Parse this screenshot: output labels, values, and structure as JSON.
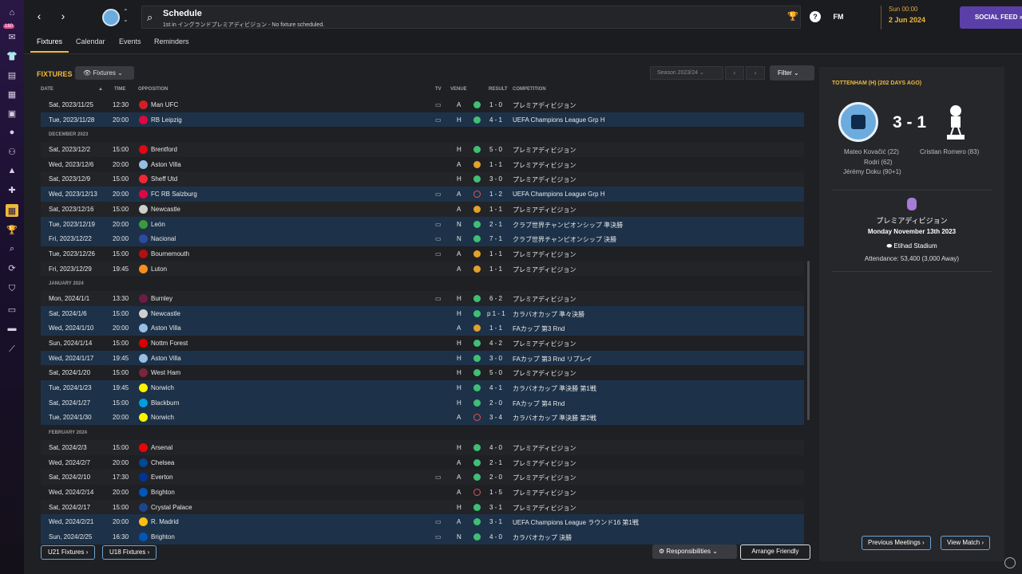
{
  "header": {
    "title": "Schedule",
    "subtitle": "1st in イングランドプレミアディビジョン - No fixture scheduled.",
    "time": "Sun 00:00",
    "date": "2 Jun 2024",
    "fm_label": "FM",
    "social_feed": "SOCIAL FEED",
    "help": "?",
    "badge": "160"
  },
  "tabs": [
    "Fixtures",
    "Calendar",
    "Events",
    "Reminders"
  ],
  "toolbar": {
    "heading": "FIXTURES",
    "dropdown": "Fixtures",
    "season": "Season 2023/24",
    "filter": "Filter"
  },
  "columns": {
    "date": "DATE",
    "time": "TIME",
    "opposition": "OPPOSITION",
    "tv": "TV",
    "venue": "VENUE",
    "result": "RESULT",
    "competition": "COMPETITION"
  },
  "rows": [
    {
      "date": "Sat, 2023/11/25",
      "time": "12:30",
      "opp": "Man UFC",
      "tv": true,
      "venue": "A",
      "res": "win",
      "score": "1 - 0",
      "comp": "プレミアディビジョン",
      "color": "#d21f26"
    },
    {
      "date": "Tue, 2023/11/28",
      "time": "20:00",
      "opp": "RB Leipzig",
      "tv": true,
      "venue": "H",
      "res": "win",
      "score": "4 - 1",
      "comp": "UEFA Champions League Grp H",
      "ucl": true,
      "color": "#dd0741"
    },
    {
      "month": "DECEMBER 2023"
    },
    {
      "date": "Sat, 2023/12/2",
      "time": "15:00",
      "opp": "Brentford",
      "tv": false,
      "venue": "H",
      "res": "win",
      "score": "5 - 0",
      "comp": "プレミアディビジョン",
      "color": "#e30613"
    },
    {
      "date": "Wed, 2023/12/6",
      "time": "20:00",
      "opp": "Aston Villa",
      "tv": false,
      "venue": "A",
      "res": "draw",
      "score": "1 - 1",
      "comp": "プレミアディビジョン",
      "color": "#95bfe5"
    },
    {
      "date": "Sat, 2023/12/9",
      "time": "15:00",
      "opp": "Sheff Utd",
      "tv": false,
      "venue": "H",
      "res": "win",
      "score": "3 - 0",
      "comp": "プレミアディビジョン",
      "color": "#ee2737"
    },
    {
      "date": "Wed, 2023/12/13",
      "time": "20:00",
      "opp": "FC RB Salzburg",
      "tv": true,
      "venue": "A",
      "res": "loss",
      "score": "1 - 2",
      "comp": "UEFA Champions League Grp H",
      "ucl": true,
      "color": "#dd0741"
    },
    {
      "date": "Sat, 2023/12/16",
      "time": "15:00",
      "opp": "Newcastle",
      "tv": false,
      "venue": "A",
      "res": "draw",
      "score": "1 - 1",
      "comp": "プレミアディビジョン",
      "color": "#cfcfcf"
    },
    {
      "date": "Tue, 2023/12/19",
      "time": "20:00",
      "opp": "León",
      "tv": true,
      "venue": "N",
      "res": "win",
      "score": "2 - 1",
      "comp": "クラブ世界チャンピオンシップ 準決勝",
      "ucl": true,
      "color": "#3a9b3a"
    },
    {
      "date": "Fri, 2023/12/22",
      "time": "20:00",
      "opp": "Nacional",
      "tv": true,
      "venue": "N",
      "res": "win",
      "score": "7 - 1",
      "comp": "クラブ世界チャンピオンシップ 決勝",
      "ucl": true,
      "color": "#2c4ba0"
    },
    {
      "date": "Tue, 2023/12/26",
      "time": "15:00",
      "opp": "Bournemouth",
      "tv": true,
      "venue": "A",
      "res": "draw",
      "score": "1 - 1",
      "comp": "プレミアディビジョン",
      "color": "#b50e12"
    },
    {
      "date": "Fri, 2023/12/29",
      "time": "19:45",
      "opp": "Luton",
      "tv": false,
      "venue": "A",
      "res": "draw",
      "score": "1 - 1",
      "comp": "プレミアディビジョン",
      "color": "#f78f1e"
    },
    {
      "month": "JANUARY 2024"
    },
    {
      "date": "Mon, 2024/1/1",
      "time": "13:30",
      "opp": "Burnley",
      "tv": true,
      "venue": "H",
      "res": "win",
      "score": "6 - 2",
      "comp": "プレミアディビジョン",
      "color": "#6c1d45"
    },
    {
      "date": "Sat, 2024/1/6",
      "time": "15:00",
      "opp": "Newcastle",
      "tv": false,
      "venue": "H",
      "res": "win",
      "score": "p 1 - 1",
      "comp": "カラバオカップ 準々決勝",
      "ucl": true,
      "color": "#cfcfcf"
    },
    {
      "date": "Wed, 2024/1/10",
      "time": "20:00",
      "opp": "Aston Villa",
      "tv": false,
      "venue": "A",
      "res": "draw",
      "score": "1 - 1",
      "comp": "FAカップ 第3 Rnd",
      "ucl": true,
      "color": "#95bfe5"
    },
    {
      "date": "Sun, 2024/1/14",
      "time": "15:00",
      "opp": "Nottm Forest",
      "tv": false,
      "venue": "H",
      "res": "win",
      "score": "4 - 2",
      "comp": "プレミアディビジョン",
      "color": "#dd0000"
    },
    {
      "date": "Wed, 2024/1/17",
      "time": "19:45",
      "opp": "Aston Villa",
      "tv": false,
      "venue": "H",
      "res": "win",
      "score": "3 - 0",
      "comp": "FAカップ 第3 Rnd リプレイ",
      "ucl": true,
      "color": "#95bfe5"
    },
    {
      "date": "Sat, 2024/1/20",
      "time": "15:00",
      "opp": "West Ham",
      "tv": false,
      "venue": "H",
      "res": "win",
      "score": "5 - 0",
      "comp": "プレミアディビジョン",
      "color": "#7a263a"
    },
    {
      "date": "Tue, 2024/1/23",
      "time": "19:45",
      "opp": "Norwich",
      "tv": false,
      "venue": "H",
      "res": "win",
      "score": "4 - 1",
      "comp": "カラバオカップ 準決勝 第1戦",
      "ucl": true,
      "color": "#fff200"
    },
    {
      "date": "Sat, 2024/1/27",
      "time": "15:00",
      "opp": "Blackburn",
      "tv": false,
      "venue": "H",
      "res": "win",
      "score": "2 - 0",
      "comp": "FAカップ 第4 Rnd",
      "ucl": true,
      "color": "#009ee0"
    },
    {
      "date": "Tue, 2024/1/30",
      "time": "20:00",
      "opp": "Norwich",
      "tv": false,
      "venue": "A",
      "res": "loss",
      "score": "3 - 4",
      "comp": "カラバオカップ 準決勝 第2戦",
      "ucl": true,
      "color": "#fff200"
    },
    {
      "month": "FEBRUARY 2024"
    },
    {
      "date": "Sat, 2024/2/3",
      "time": "15:00",
      "opp": "Arsenal",
      "tv": false,
      "venue": "H",
      "res": "win",
      "score": "4 - 0",
      "comp": "プレミアディビジョン",
      "color": "#ef0107"
    },
    {
      "date": "Wed, 2024/2/7",
      "time": "20:00",
      "opp": "Chelsea",
      "tv": false,
      "venue": "A",
      "res": "win",
      "score": "2 - 1",
      "comp": "プレミアディビジョン",
      "color": "#034694"
    },
    {
      "date": "Sat, 2024/2/10",
      "time": "17:30",
      "opp": "Everton",
      "tv": true,
      "venue": "A",
      "res": "win",
      "score": "2 - 0",
      "comp": "プレミアディビジョン",
      "color": "#003399"
    },
    {
      "date": "Wed, 2024/2/14",
      "time": "20:00",
      "opp": "Brighton",
      "tv": false,
      "venue": "A",
      "res": "loss",
      "score": "1 - 5",
      "comp": "プレミアディビジョン",
      "color": "#0057b8"
    },
    {
      "date": "Sat, 2024/2/17",
      "time": "15:00",
      "opp": "Crystal Palace",
      "tv": false,
      "venue": "H",
      "res": "win",
      "score": "3 - 1",
      "comp": "プレミアディビジョン",
      "color": "#1b458f"
    },
    {
      "date": "Wed, 2024/2/21",
      "time": "20:00",
      "opp": "R. Madrid",
      "tv": true,
      "venue": "A",
      "res": "win",
      "score": "3 - 1",
      "comp": "UEFA Champions League ラウンド16 第1戦",
      "ucl": true,
      "color": "#febe10"
    },
    {
      "date": "Sun, 2024/2/25",
      "time": "16:30",
      "opp": "Brighton",
      "tv": true,
      "venue": "N",
      "res": "win",
      "score": "4 - 0",
      "comp": "カラバオカップ 決勝",
      "ucl": true,
      "color": "#0057b8"
    }
  ],
  "bottom": {
    "u21": "U21 Fixtures",
    "u18": "U18 Fixtures",
    "responsibilities": "Responsibilities",
    "arrange": "Arrange Friendly"
  },
  "panel": {
    "title": "TOTTENHAM (H) (202 DAYS AGO)",
    "score": "3 - 1",
    "home_scorers": [
      "Mateo Kovačić (22)",
      "Rodri (62)",
      "Jérémy Doku (90+1)"
    ],
    "away_scorers": [
      "Cristian Romero (83)"
    ],
    "competition": "プレミアディビジョン",
    "date": "Monday November 13th 2023",
    "stadium": "Etihad Stadium",
    "attendance": "Attendance: 53,400 (3,000 Away)",
    "prev": "Previous Meetings",
    "view": "View Match"
  }
}
